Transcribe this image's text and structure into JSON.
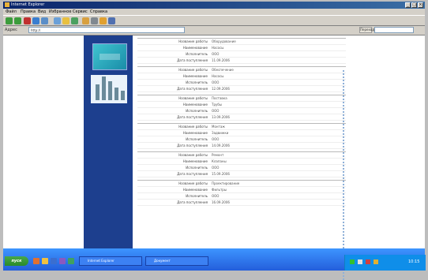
{
  "window": {
    "title": "Internet Explorer",
    "minimize": "_",
    "maximize": "□",
    "close": "×"
  },
  "menu": [
    "Файл",
    "Правка",
    "Вид",
    "Избранное",
    "Сервис",
    "Справка"
  ],
  "address": {
    "label": "Адрес",
    "url": "http://",
    "go_label": "Переход"
  },
  "taskbar": {
    "start_label": "пуск",
    "tasks": [
      "Internet Explorer",
      "Документ"
    ],
    "clock": "10:15"
  },
  "sections": [
    {
      "rows": [
        {
          "label": "Название работы",
          "value": "Оборудование"
        },
        {
          "label": "Наименование",
          "value": "Насосы"
        },
        {
          "label": "Исполнитель",
          "value": "ООО"
        },
        {
          "label": "Дата поступления",
          "value": "11.09.2006"
        }
      ]
    },
    {
      "rows": [
        {
          "label": "Название работы",
          "value": "Обеспечение"
        },
        {
          "label": "Наименование",
          "value": "Насосы"
        },
        {
          "label": "Исполнитель",
          "value": "ООО"
        },
        {
          "label": "Дата поступления",
          "value": "12.09.2006"
        }
      ]
    },
    {
      "rows": [
        {
          "label": "Название работы",
          "value": "Поставка"
        },
        {
          "label": "Наименование",
          "value": "Трубы"
        },
        {
          "label": "Исполнитель",
          "value": "ООО"
        },
        {
          "label": "Дата поступления",
          "value": "13.09.2006"
        }
      ]
    },
    {
      "rows": [
        {
          "label": "Название работы",
          "value": "Монтаж"
        },
        {
          "label": "Наименование",
          "value": "Задвижки"
        },
        {
          "label": "Исполнитель",
          "value": "ООО"
        },
        {
          "label": "Дата поступления",
          "value": "14.09.2006"
        }
      ]
    },
    {
      "rows": [
        {
          "label": "Название работы",
          "value": "Ремонт"
        },
        {
          "label": "Наименование",
          "value": "Клапаны"
        },
        {
          "label": "Исполнитель",
          "value": "ООО"
        },
        {
          "label": "Дата поступления",
          "value": "15.09.2006"
        }
      ]
    },
    {
      "rows": [
        {
          "label": "Название работы",
          "value": "Проектирование"
        },
        {
          "label": "Наименование",
          "value": "Фильтры"
        },
        {
          "label": "Исполнитель",
          "value": "ООО"
        },
        {
          "label": "Дата поступления",
          "value": "16.09.2006"
        }
      ]
    }
  ]
}
